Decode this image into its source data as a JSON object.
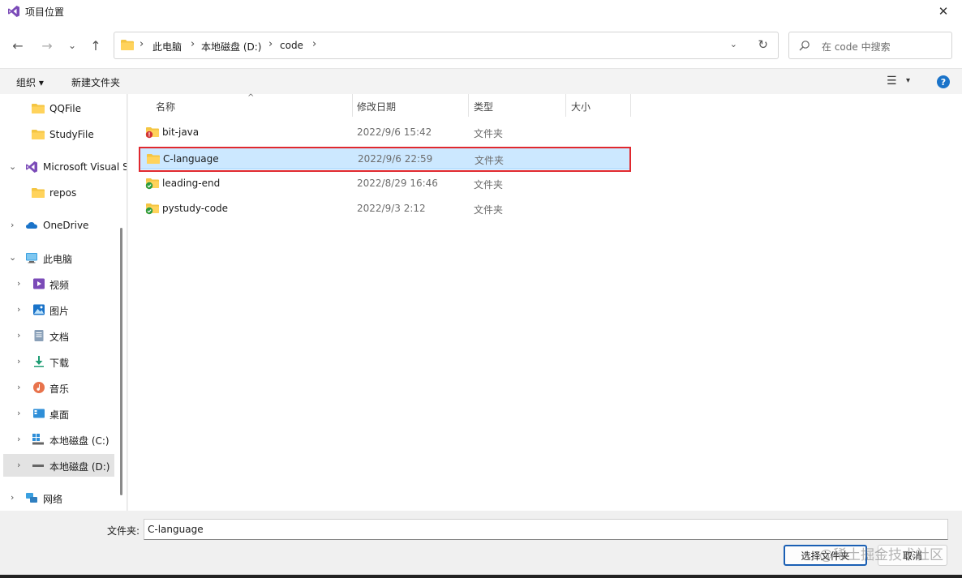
{
  "window": {
    "title": "项目位置",
    "close": "✕"
  },
  "nav": {
    "back": "←",
    "forward": "→",
    "recent": "⌄",
    "up": "↑",
    "breadcrumb": [
      "此电脑",
      "本地磁盘 (D:)",
      "code"
    ],
    "sep": "›",
    "dropdown": "⌄",
    "refresh": "↻",
    "search_placeholder": "在 code 中搜索"
  },
  "toolbar": {
    "organize": "组织 ▾",
    "new_folder": "新建文件夹",
    "view": "☰",
    "view_drop": "▾",
    "help": "?"
  },
  "sidebar": {
    "items": [
      {
        "label": "QQFile",
        "chevron": "",
        "icon": "folder-icon"
      },
      {
        "label": "StudyFile",
        "chevron": "",
        "icon": "folder-icon"
      },
      {
        "label": "Microsoft Visual Studio",
        "chevron": "⌄",
        "icon": "visual-studio-icon"
      },
      {
        "label": "repos",
        "chevron": "",
        "icon": "folder-icon"
      },
      {
        "label": "OneDrive",
        "chevron": "›",
        "icon": "onedrive-icon"
      },
      {
        "label": "此电脑",
        "chevron": "⌄",
        "icon": "computer-icon"
      },
      {
        "label": "视频",
        "chevron": "›",
        "icon": "video-icon"
      },
      {
        "label": "图片",
        "chevron": "›",
        "icon": "pictures-icon"
      },
      {
        "label": "文档",
        "chevron": "›",
        "icon": "documents-icon"
      },
      {
        "label": "下载",
        "chevron": "›",
        "icon": "download-icon"
      },
      {
        "label": "音乐",
        "chevron": "›",
        "icon": "music-icon"
      },
      {
        "label": "桌面",
        "chevron": "›",
        "icon": "desktop-icon"
      },
      {
        "label": "本地磁盘 (C:)",
        "chevron": "›",
        "icon": "drive-c-icon"
      },
      {
        "label": "本地磁盘 (D:)",
        "chevron": "›",
        "icon": "drive-d-icon"
      },
      {
        "label": "网络",
        "chevron": "›",
        "icon": "network-icon"
      }
    ]
  },
  "columns": {
    "name": "名称",
    "modified": "修改日期",
    "type": "类型",
    "size": "大小",
    "sort_caret": "^"
  },
  "files": [
    {
      "name": "bit-java",
      "modified": "2022/9/6 15:42",
      "type": "文件夹",
      "icon": "folder-error-icon"
    },
    {
      "name": "C-language",
      "modified": "2022/9/6 22:59",
      "type": "文件夹",
      "icon": "folder-icon"
    },
    {
      "name": "leading-end",
      "modified": "2022/8/29 16:46",
      "type": "文件夹",
      "icon": "folder-synced-icon"
    },
    {
      "name": "pystudy-code",
      "modified": "2022/9/3 2:12",
      "type": "文件夹",
      "icon": "folder-synced-icon"
    }
  ],
  "footer": {
    "folder_label": "文件夹:",
    "folder_value": "C-language",
    "select_button": "选择文件夹",
    "cancel_button": "取消",
    "watermark": "@稀土掘金技术社区"
  },
  "colors": {
    "accent": "#1a5fb4",
    "selection": "#cce8ff",
    "highlight": "#e0282e",
    "folder": "#f4c542"
  }
}
